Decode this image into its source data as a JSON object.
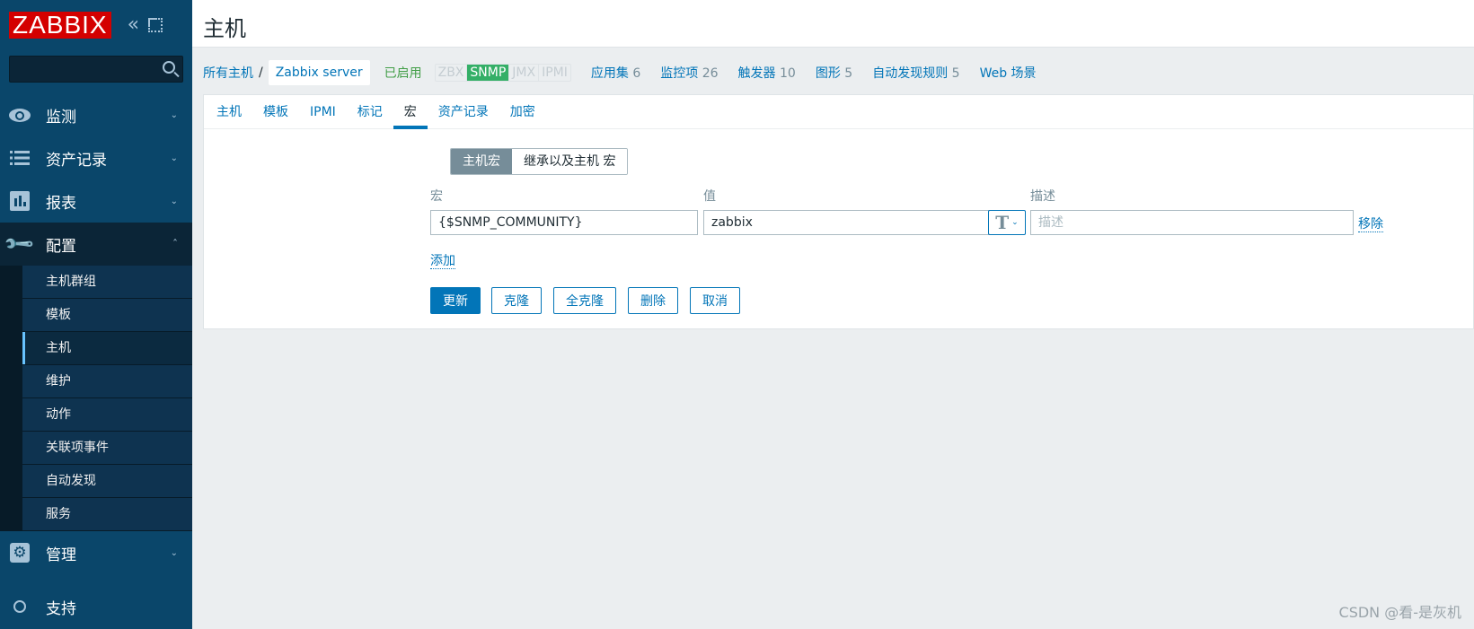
{
  "sidebar": {
    "logo": "ZABBIX",
    "search": {
      "value": "",
      "placeholder": ""
    },
    "menu": [
      {
        "label": "监测",
        "icon": "eye-icon"
      },
      {
        "label": "资产记录",
        "icon": "list-icon"
      },
      {
        "label": "报表",
        "icon": "bar-chart-icon"
      },
      {
        "label": "配置",
        "icon": "wrench-icon",
        "open": true
      },
      {
        "label": "管理",
        "icon": "gear-icon"
      },
      {
        "label": "支持",
        "icon": "support-icon"
      }
    ],
    "submenu": [
      {
        "label": "主机群组"
      },
      {
        "label": "模板"
      },
      {
        "label": "主机",
        "active": true
      },
      {
        "label": "维护"
      },
      {
        "label": "动作"
      },
      {
        "label": "关联项事件"
      },
      {
        "label": "自动发现"
      },
      {
        "label": "服务"
      }
    ]
  },
  "header": {
    "title": "主机"
  },
  "breadcrumb": {
    "all_hosts": "所有主机",
    "separator": "/",
    "current": "Zabbix server",
    "status": "已启用",
    "availability": [
      {
        "label": "ZBX",
        "active": false
      },
      {
        "label": "SNMP",
        "active": true
      },
      {
        "label": "JMX",
        "active": false
      },
      {
        "label": "IPMI",
        "active": false
      }
    ],
    "links": [
      {
        "label": "应用集",
        "count": "6"
      },
      {
        "label": "监控项",
        "count": "26"
      },
      {
        "label": "触发器",
        "count": "10"
      },
      {
        "label": "图形",
        "count": "5"
      },
      {
        "label": "自动发现规则",
        "count": "5"
      },
      {
        "label": "Web 场景",
        "count": ""
      }
    ]
  },
  "tabs": [
    {
      "label": "主机"
    },
    {
      "label": "模板"
    },
    {
      "label": "IPMI"
    },
    {
      "label": "标记"
    },
    {
      "label": "宏",
      "active": true
    },
    {
      "label": "资产记录"
    },
    {
      "label": "加密"
    }
  ],
  "macros": {
    "toggle": {
      "host": "主机宏",
      "inherited": "继承以及主机 宏"
    },
    "columns": {
      "macro": "宏",
      "value": "值",
      "description": "描述"
    },
    "rows": [
      {
        "macro": "{$SNMP_COMMUNITY}",
        "value": "zabbix",
        "type_icon": "text-type-icon",
        "description": "",
        "description_placeholder": "描述",
        "remove": "移除"
      }
    ],
    "add": "添加"
  },
  "buttons": {
    "update": "更新",
    "clone": "克隆",
    "full_clone": "全克隆",
    "delete": "删除",
    "cancel": "取消"
  },
  "colors": {
    "sidebar": "#0a466a",
    "accent": "#0275b8",
    "enabled": "#429e47",
    "snmp_on": "#34af67",
    "logo": "#d40000"
  },
  "watermark": "CSDN @看-是灰机"
}
